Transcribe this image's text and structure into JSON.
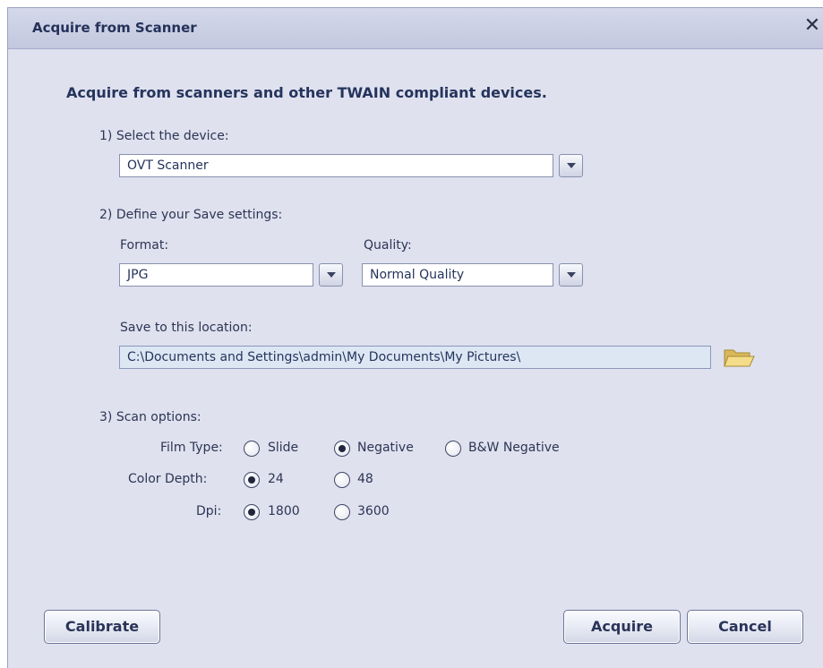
{
  "window": {
    "title": "Acquire from Scanner",
    "close_glyph": "✕"
  },
  "heading": "Acquire from scanners and other TWAIN compliant devices.",
  "step1": {
    "label": "1) Select the device:",
    "device_value": "OVT Scanner"
  },
  "step2": {
    "label": "2) Define your Save settings:",
    "format_label": "Format:",
    "format_value": "JPG",
    "quality_label": "Quality:",
    "quality_value": "Normal Quality",
    "location_label": "Save to this location:",
    "location_value": "C:\\Documents and Settings\\admin\\My Documents\\My Pictures\\"
  },
  "step3": {
    "label": "3) Scan options:",
    "film_type": {
      "label": "Film Type:",
      "options": [
        "Slide",
        "Negative",
        "B&W Negative"
      ],
      "selected": "Negative"
    },
    "color_depth": {
      "label": "Color Depth:",
      "options": [
        "24",
        "48"
      ],
      "selected": "24"
    },
    "dpi": {
      "label": "Dpi:",
      "options": [
        "1800",
        "3600"
      ],
      "selected": "1800"
    }
  },
  "buttons": {
    "calibrate": "Calibrate",
    "acquire": "Acquire",
    "cancel": "Cancel"
  },
  "icons": {
    "dropdown": "chevron-down-icon",
    "browse": "folder-icon"
  },
  "colors": {
    "dialog_bg": "#dfe1ef",
    "title_text": "#24325a",
    "path_field_bg": "#dde7f4",
    "folder": "#f2d47a"
  }
}
